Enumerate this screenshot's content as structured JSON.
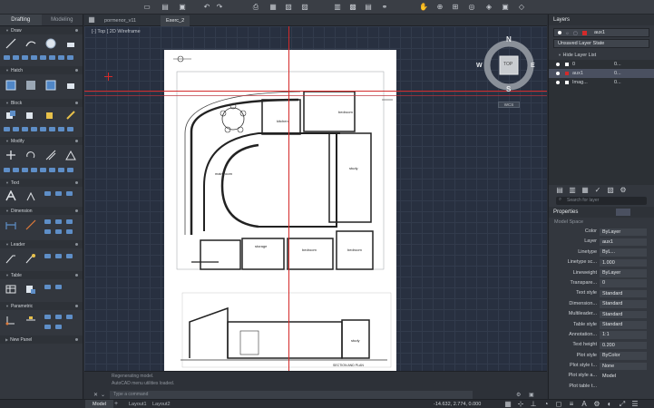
{
  "palette": {
    "tabs": [
      "Drafting",
      "Modeling"
    ],
    "sections": [
      {
        "title": "Draw"
      },
      {
        "title": "Hatch"
      },
      {
        "title": "Block"
      },
      {
        "title": "Modify"
      },
      {
        "title": "Text"
      },
      {
        "title": "Dimension"
      },
      {
        "title": "Leader"
      },
      {
        "title": "Table"
      },
      {
        "title": "Parametric"
      },
      {
        "title": "New Panel"
      }
    ]
  },
  "documents": {
    "tabs": [
      "pormenor_v11",
      "Exerc_2"
    ],
    "active": "Exerc_2",
    "view_label": "[-]  Top  [  2D Wireframe"
  },
  "drawing": {
    "labels": [
      "kitchen",
      "bedroom",
      "study",
      "main room",
      "storage",
      "bedroom",
      "bedroom",
      "study"
    ],
    "section_title": "SECTION AND PLAN"
  },
  "viewcube": {
    "top": "TOP",
    "north": "N",
    "south": "S",
    "east": "E",
    "west": "W",
    "wcs": "WCS"
  },
  "command": {
    "lines": [
      "Regenerating model.",
      "AutoCAD menu utilities loaded."
    ],
    "placeholder": "Type a command"
  },
  "layers": {
    "title": "Layers",
    "current": "aux1",
    "state": "Unsaved Layer State",
    "hide_list": "Hide Layer List",
    "list": [
      {
        "name": "0",
        "value": "0...",
        "color": "#ffffff"
      },
      {
        "name": "aux1",
        "value": "0...",
        "color": "#d42a2a"
      },
      {
        "name": "Imag...",
        "value": "0...",
        "color": "#ffffff"
      }
    ],
    "search_placeholder": "Search for layer"
  },
  "properties": {
    "title": "Properties",
    "scope": "Model Space",
    "rows": [
      {
        "label": "Color",
        "value": "ByLayer"
      },
      {
        "label": "Layer",
        "value": "aux1"
      },
      {
        "label": "Linetype",
        "value": "ByL..."
      },
      {
        "label": "Linetype sc...",
        "value": "1.000"
      },
      {
        "label": "Lineweight",
        "value": "ByLayer"
      },
      {
        "label": "Transpare...",
        "value": "0"
      },
      {
        "label": "Text style",
        "value": "Standard"
      },
      {
        "label": "Dimension...",
        "value": "Standard"
      },
      {
        "label": "Multileader...",
        "value": "Standard"
      },
      {
        "label": "Table style",
        "value": "Standard"
      },
      {
        "label": "Annotation...",
        "value": "1:1"
      },
      {
        "label": "Text height",
        "value": "0.200"
      },
      {
        "label": "Plot style",
        "value": "ByColor"
      },
      {
        "label": "Plot style t...",
        "value": "None"
      },
      {
        "label": "Plot style a...",
        "value": "Model"
      },
      {
        "label": "Plot table t...",
        "value": ""
      }
    ]
  },
  "status": {
    "tabs": [
      "Model",
      "Layout1",
      "Layout2"
    ],
    "coords": "-14.632, 2.774, 0.000"
  },
  "colors": {
    "accent": "#5e8ec7",
    "crosshair": "#d42a2a"
  }
}
